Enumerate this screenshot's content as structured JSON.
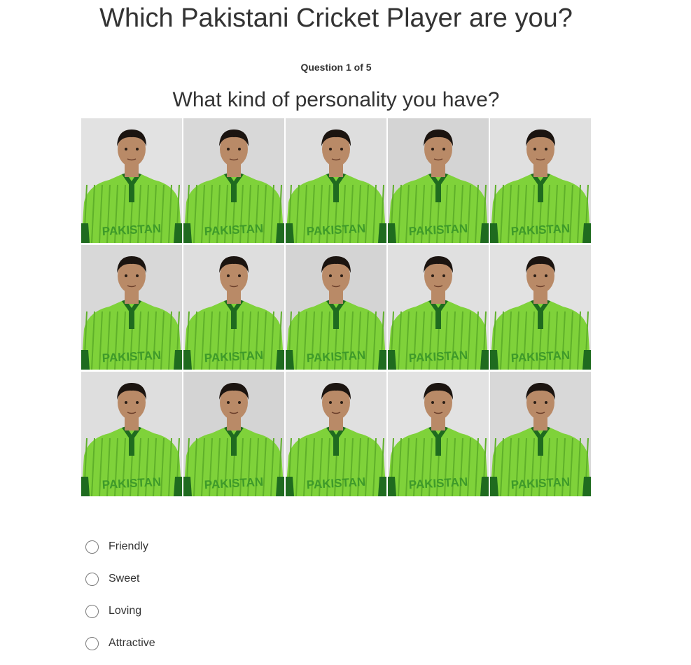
{
  "quiz": {
    "title": "Which Pakistani Cricket Player are you?",
    "counter": "Question 1 of 5",
    "question": "What kind of personality you have?",
    "image_alt": "Pakistan cricket team player portraits",
    "jersey_text": "PAKISTAN",
    "options": [
      {
        "label": "Friendly"
      },
      {
        "label": "Sweet"
      },
      {
        "label": "Loving"
      },
      {
        "label": "Attractive"
      }
    ]
  },
  "colors": {
    "jersey": "#7fd23a",
    "jersey_dark": "#1f6b1f",
    "background_tile": "#dcdcdc",
    "skin": "#b98a67",
    "hair": "#1b1410"
  }
}
